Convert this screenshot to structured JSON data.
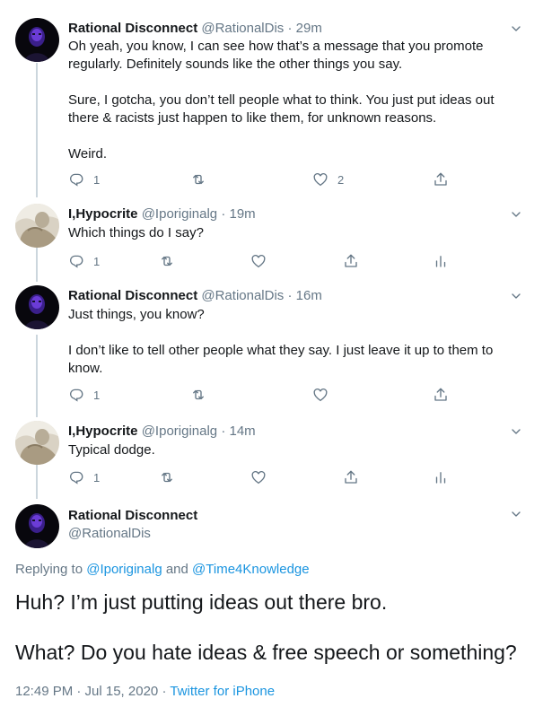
{
  "tweets": [
    {
      "name": "Rational Disconnect",
      "handle": "@RationalDis",
      "sep": "·",
      "time": "29m",
      "avatar": "dark-purple-avatar",
      "paragraphs": [
        "Oh yeah, you know, I can see how that’s a message that you promote regularly. Definitely sounds like the other things you say.",
        "Sure, I gotcha, you don’t tell people what to think. You just put ideas out there & racists just happen to like them, for unknown reasons.",
        "Weird."
      ],
      "reply_count": "1",
      "retweet_count": "",
      "like_count": "2"
    },
    {
      "name": "I,Hypocrite",
      "handle": "@Iporiginalg",
      "sep": "·",
      "time": "19m",
      "avatar": "statue-avatar",
      "paragraphs": [
        "Which things do I say?"
      ],
      "reply_count": "1",
      "retweet_count": "",
      "like_count": ""
    },
    {
      "name": "Rational Disconnect",
      "handle": "@RationalDis",
      "sep": "·",
      "time": "16m",
      "avatar": "dark-purple-avatar",
      "paragraphs": [
        "Just things, you know?",
        "I don’t like to tell other people what they say. I just leave it up to them to know."
      ],
      "reply_count": "1",
      "retweet_count": "",
      "like_count": ""
    },
    {
      "name": "I,Hypocrite",
      "handle": "@Iporiginalg",
      "sep": "·",
      "time": "14m",
      "avatar": "statue-avatar",
      "paragraphs": [
        "Typical dodge."
      ],
      "reply_count": "1",
      "retweet_count": "",
      "like_count": ""
    }
  ],
  "main": {
    "name": "Rational Disconnect",
    "handle": "@RationalDis",
    "replying_prefix": "Replying to",
    "reply_to_1": "@Iporiginalg",
    "and": "and",
    "reply_to_2": "@Time4Knowledge",
    "paragraphs": [
      "Huh? I’m just putting ideas out there bro.",
      "What? Do you hate ideas & free speech or something?"
    ],
    "timestamp": "12:49 PM · Jul 15, 2020",
    "sep": "·",
    "source": "Twitter for iPhone"
  },
  "colors": {
    "text": "#14171a",
    "muted": "#657786",
    "link": "#1b95e0",
    "thread_line": "#ccd6dd"
  },
  "icons": [
    "reply-icon",
    "retweet-icon",
    "like-icon",
    "share-icon",
    "analytics-icon",
    "chevron-down-icon"
  ]
}
